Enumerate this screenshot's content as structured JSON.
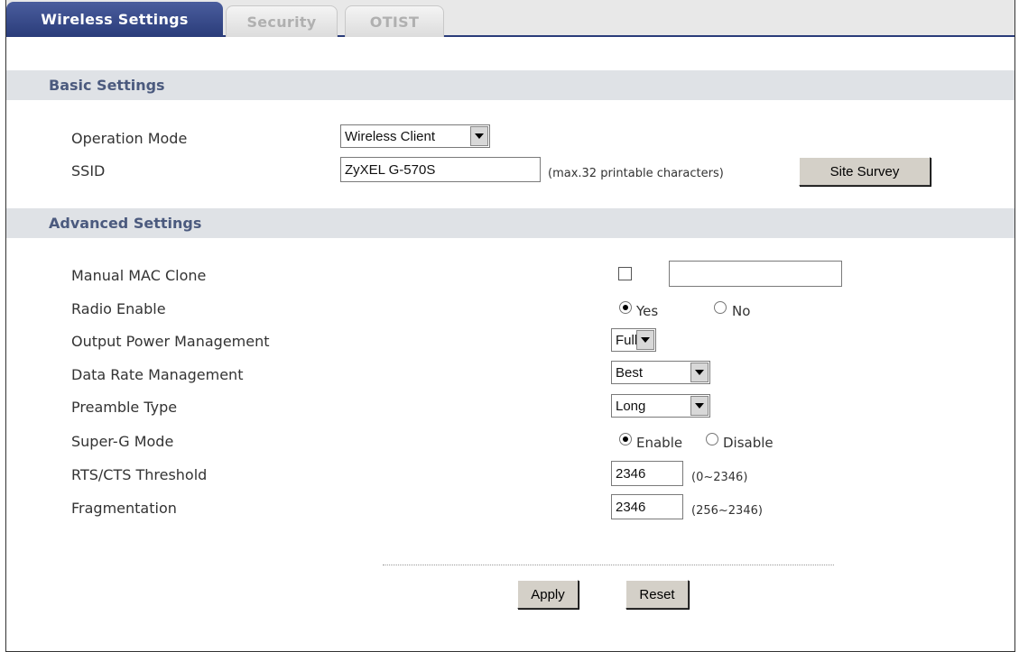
{
  "tabs": [
    {
      "label": "Wireless Settings",
      "active": true
    },
    {
      "label": "Security",
      "active": false
    },
    {
      "label": "OTIST",
      "active": false
    }
  ],
  "basic": {
    "title": "Basic Settings",
    "operation_mode": {
      "label": "Operation Mode",
      "value": "Wireless Client"
    },
    "ssid": {
      "label": "SSID",
      "value": "ZyXEL G-570S",
      "hint": "(max.32 printable characters)"
    },
    "site_survey_label": "Site Survey"
  },
  "advanced": {
    "title": "Advanced Settings",
    "mac_clone": {
      "label": "Manual MAC Clone",
      "checked": false,
      "value": ""
    },
    "radio_enable": {
      "label": "Radio Enable",
      "yes": "Yes",
      "no": "No",
      "selected": "Yes"
    },
    "output_power": {
      "label": "Output Power Management",
      "value": "Full"
    },
    "data_rate": {
      "label": "Data Rate Management",
      "value": "Best"
    },
    "preamble": {
      "label": "Preamble Type",
      "value": "Long"
    },
    "super_g": {
      "label": "Super-G Mode",
      "enable": "Enable",
      "disable": "Disable",
      "selected": "Enable"
    },
    "rts_cts": {
      "label": "RTS/CTS Threshold",
      "value": "2346",
      "hint": "(0~2346)"
    },
    "fragmentation": {
      "label": "Fragmentation",
      "value": "2346",
      "hint": "(256~2346)"
    }
  },
  "actions": {
    "apply_label": "Apply",
    "reset_label": "Reset"
  },
  "colors": {
    "tab_active": "#2a3c7a",
    "section_bar": "#dfe2e6",
    "section_text": "#4b5a7e"
  }
}
